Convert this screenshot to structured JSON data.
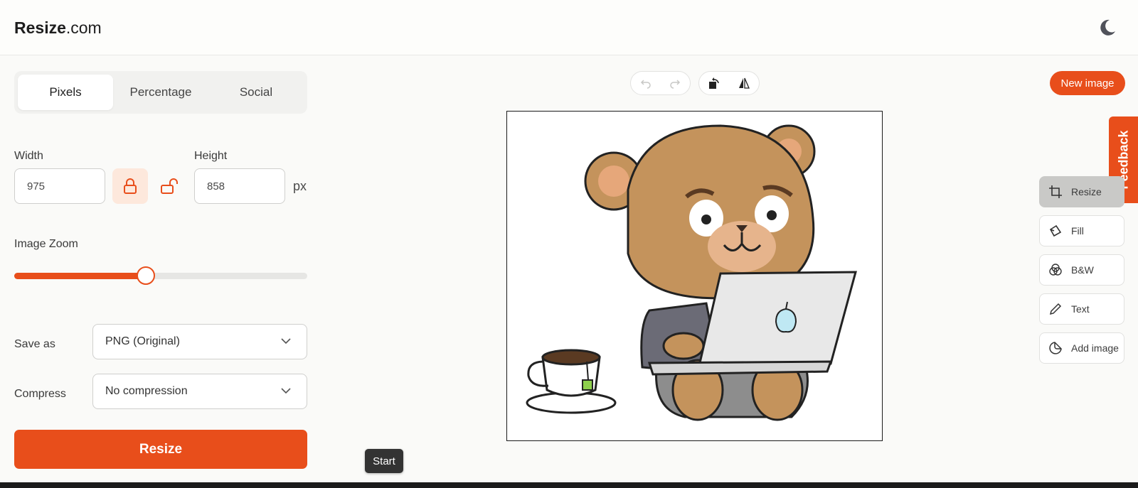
{
  "app": {
    "logo_bold": "Resize",
    "logo_rest": ".com"
  },
  "tabs": [
    {
      "label": "Pixels",
      "active": true
    },
    {
      "label": "Percentage",
      "active": false
    },
    {
      "label": "Social",
      "active": false
    }
  ],
  "dimensions": {
    "width_label": "Width",
    "width_value": "975",
    "height_label": "Height",
    "height_value": "858",
    "unit": "px",
    "aspect_locked": true
  },
  "zoom": {
    "label": "Image Zoom",
    "value": 0.45
  },
  "save_as": {
    "label": "Save as",
    "value": "PNG (Original)"
  },
  "compress": {
    "label": "Compress",
    "value": "No compression"
  },
  "actions": {
    "resize_label": "Resize",
    "new_image_label": "New image",
    "feedback_label": "Feedback",
    "start_label": "Start"
  },
  "tools": [
    {
      "label": "Resize",
      "icon": "crop-icon",
      "active": true
    },
    {
      "label": "Fill",
      "icon": "fill-icon",
      "active": false
    },
    {
      "label": "B&W",
      "icon": "bw-circles-icon",
      "active": false
    },
    {
      "label": "Text",
      "icon": "pencil-icon",
      "active": false
    },
    {
      "label": "Add image",
      "icon": "sticker-icon",
      "active": false
    }
  ],
  "colors": {
    "accent": "#e84e1b",
    "accent_soft": "#fde8dc"
  }
}
